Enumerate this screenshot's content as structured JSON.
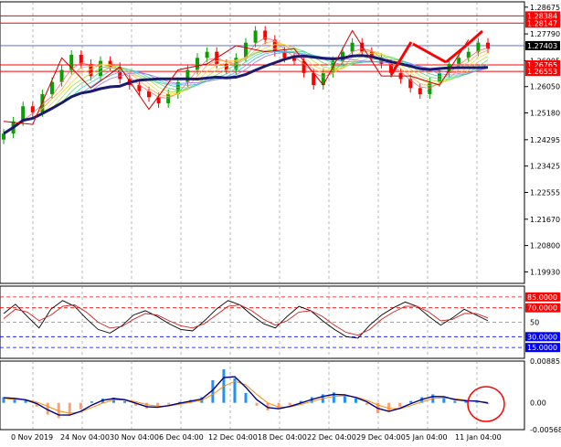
{
  "chart_data": [
    {
      "type": "candlestick",
      "panel": "main",
      "y_ticks": [
        "1.28675",
        "1.27790",
        "1.26905",
        "1.26050",
        "1.25180",
        "1.24295",
        "1.23425",
        "1.22555",
        "1.21670",
        "1.20800",
        "1.19930"
      ],
      "ylim": [
        1.1955,
        1.2885
      ],
      "x_dates": [
        "0 Nov 2019",
        "24 Nov 04:00",
        "30 Nov 04:00",
        "6 Dec 04:00",
        "12 Dec 04:00",
        "18 Dec 04:00",
        "22 Dec 04:00",
        "29 Dec 04:00",
        "5 Jan 04:00",
        "11 Jan 04:00"
      ],
      "current_price": {
        "label": "1.27403",
        "value": 1.27403,
        "color": "#000000"
      },
      "horizontal_levels": [
        {
          "label": "1.28384",
          "value": 1.28384,
          "color": "#ff0000"
        },
        {
          "label": "1.28147",
          "value": 1.28147,
          "color": "#ff0000"
        },
        {
          "label": "1.26765",
          "value": 1.26765,
          "color": "#ff0000"
        },
        {
          "label": "1.26553",
          "value": 1.26553,
          "color": "#ff0000"
        }
      ],
      "blue_level": 1.27403,
      "close_series": [
        1.245,
        1.249,
        1.254,
        1.252,
        1.258,
        1.262,
        1.266,
        1.271,
        1.268,
        1.264,
        1.269,
        1.267,
        1.263,
        1.261,
        1.259,
        1.257,
        1.255,
        1.258,
        1.262,
        1.266,
        1.27,
        1.272,
        1.268,
        1.266,
        1.27,
        1.275,
        1.279,
        1.276,
        1.272,
        1.27,
        1.269,
        1.265,
        1.261,
        1.265,
        1.269,
        1.272,
        1.275,
        1.272,
        1.27,
        1.268,
        1.265,
        1.263,
        1.26,
        1.258,
        1.262,
        1.265,
        1.268,
        1.27,
        1.272,
        1.275,
        1.273
      ],
      "colors": {
        "bull": "#0aa000",
        "bear": "#ff0000",
        "ma": "#1a1a6e",
        "zigzag": "#cc0000"
      }
    },
    {
      "type": "line",
      "panel": "stochastic",
      "levels": [
        {
          "label": "85.0000",
          "value": 85,
          "color": "#ff0000"
        },
        {
          "label": "70.0000",
          "value": 70,
          "color": "#ff0000"
        },
        {
          "label": "50",
          "value": 50,
          "color": "#888888"
        },
        {
          "label": "30.0000",
          "value": 30,
          "color": "#0000ff"
        },
        {
          "label": "15.0000",
          "value": 15,
          "color": "#0000ff"
        }
      ],
      "ylim": [
        0,
        100
      ],
      "series": [
        {
          "values": [
            62,
            75,
            58,
            42,
            68,
            80,
            72,
            55,
            40,
            35,
            45,
            60,
            66,
            58,
            48,
            40,
            38,
            52,
            68,
            80,
            74,
            60,
            48,
            42,
            58,
            72,
            66,
            52,
            40,
            30,
            28,
            46,
            60,
            70,
            78,
            72,
            58,
            46,
            56,
            68,
            60,
            52
          ]
        },
        {
          "values": [
            55,
            68,
            64,
            52,
            60,
            72,
            74,
            64,
            50,
            42,
            44,
            54,
            62,
            60,
            52,
            45,
            42,
            48,
            60,
            72,
            74,
            66,
            54,
            46,
            52,
            64,
            66,
            58,
            46,
            36,
            32,
            40,
            54,
            64,
            72,
            72,
            64,
            52,
            54,
            62,
            62,
            56
          ]
        }
      ]
    },
    {
      "type": "bar",
      "panel": "macd",
      "y_ticks": [
        "0.0088517",
        "0.00",
        "-0.005683"
      ],
      "ylim": [
        -0.005683,
        0.0088517
      ],
      "histogram": [
        0.0012,
        0.0009,
        0.0005,
        -0.0008,
        -0.0025,
        -0.0032,
        -0.0026,
        -0.0014,
        0.0003,
        0.0009,
        0.0011,
        0.0004,
        -0.0006,
        -0.0012,
        -0.0009,
        -0.0004,
        0.0002,
        0.0006,
        0.0012,
        0.0048,
        0.0071,
        0.0052,
        0.0021,
        -0.0006,
        -0.0016,
        -0.0012,
        -0.0005,
        0.0004,
        0.0012,
        0.0018,
        0.0022,
        0.0016,
        0.0009,
        -0.0004,
        -0.0022,
        -0.0018,
        -0.0008,
        0.0004,
        0.0012,
        0.0018,
        0.0011,
        0.0004,
        0.0006,
        0.0002,
        -0.0003
      ],
      "signal_color": "#ff8c00",
      "macd_color": "#000080",
      "hist_pos_color": "#1e90ff",
      "hist_neg_color": "#ff9f70"
    }
  ]
}
